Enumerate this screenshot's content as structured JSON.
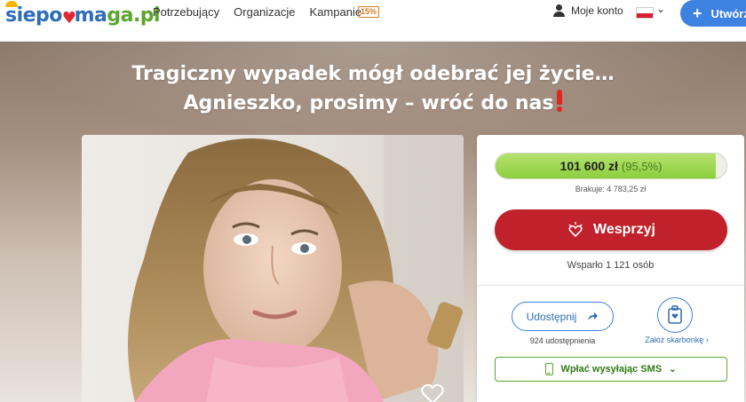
{
  "nav": {
    "logo": {
      "part1": "siepo",
      "part2": "ma",
      "part3": "ga.pl"
    },
    "links": [
      "Potrzebujący",
      "Organizacje",
      "Kampanie"
    ],
    "badge": "15%",
    "account_label": "Moje konto",
    "create_label": "Utwórz"
  },
  "hero": {
    "title_line1": "Tragiczny wypadek mógł odebrać jej życie…",
    "title_line2": "Agnieszko, prosimy – wróć do nas"
  },
  "donation": {
    "amount": "101 600 zł",
    "percent_text": "(95,5%)",
    "progress_fraction": 0.955,
    "missing": "Brakuje: 4 783,25 zł",
    "support_label": "Wesprzyj",
    "supported_count": "Wsparło 1 121 osób",
    "share_label": "Udostępnij",
    "share_count": "924 udostępnienia",
    "piggy_label": "Załóż skarbonkę",
    "sms_label": "Wpłać wysyłając SMS"
  },
  "colors": {
    "brand_blue": "#2f6db8",
    "brand_green": "#5aa52d",
    "support_red": "#c0212a",
    "progress_green": "#8ccf3f"
  }
}
